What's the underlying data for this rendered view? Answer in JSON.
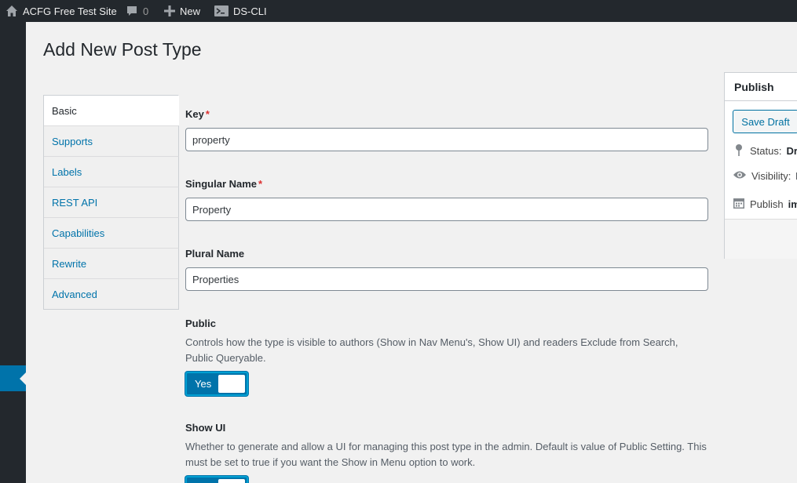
{
  "adminbar": {
    "site_name": "ACFG Free Test Site",
    "comments_count": "0",
    "new_label": "New",
    "cli_label": "DS-CLI",
    "icons": [
      "home-icon",
      "comment-icon",
      "plus-icon",
      "terminal-icon"
    ]
  },
  "page": {
    "title": "Add New Post Type"
  },
  "tabs": [
    {
      "label": "Basic",
      "active": true
    },
    {
      "label": "Supports"
    },
    {
      "label": "Labels"
    },
    {
      "label": "REST API"
    },
    {
      "label": "Capabilities"
    },
    {
      "label": "Rewrite"
    },
    {
      "label": "Advanced"
    }
  ],
  "form": {
    "key": {
      "label": "Key",
      "required_mark": "*",
      "value": "property"
    },
    "singular": {
      "label": "Singular Name",
      "required_mark": "*",
      "value": "Property"
    },
    "plural": {
      "label": "Plural Name",
      "value": "Properties"
    },
    "public": {
      "label": "Public",
      "description": "Controls how the type is visible to authors (Show in Nav Menu's, Show UI) and readers Exclude from Search, Public Queryable.",
      "toggle_label": "Yes"
    },
    "show_ui": {
      "label": "Show UI",
      "description": "Whether to generate and allow a UI for managing this post type in the admin. Default is value of Public Setting. This must be set to true if you want the Show in Menu option to work."
    }
  },
  "publish": {
    "title": "Publish",
    "save_draft": "Save Draft",
    "status_label": "Status:",
    "status_value": "Dr",
    "visibility_label": "Visibility:",
    "visibility_value": "I",
    "publish_label": "Publish",
    "publish_value": "im"
  },
  "colors": {
    "accent": "#0073aa",
    "adminbar": "#23282d",
    "required": "#dc3232"
  }
}
